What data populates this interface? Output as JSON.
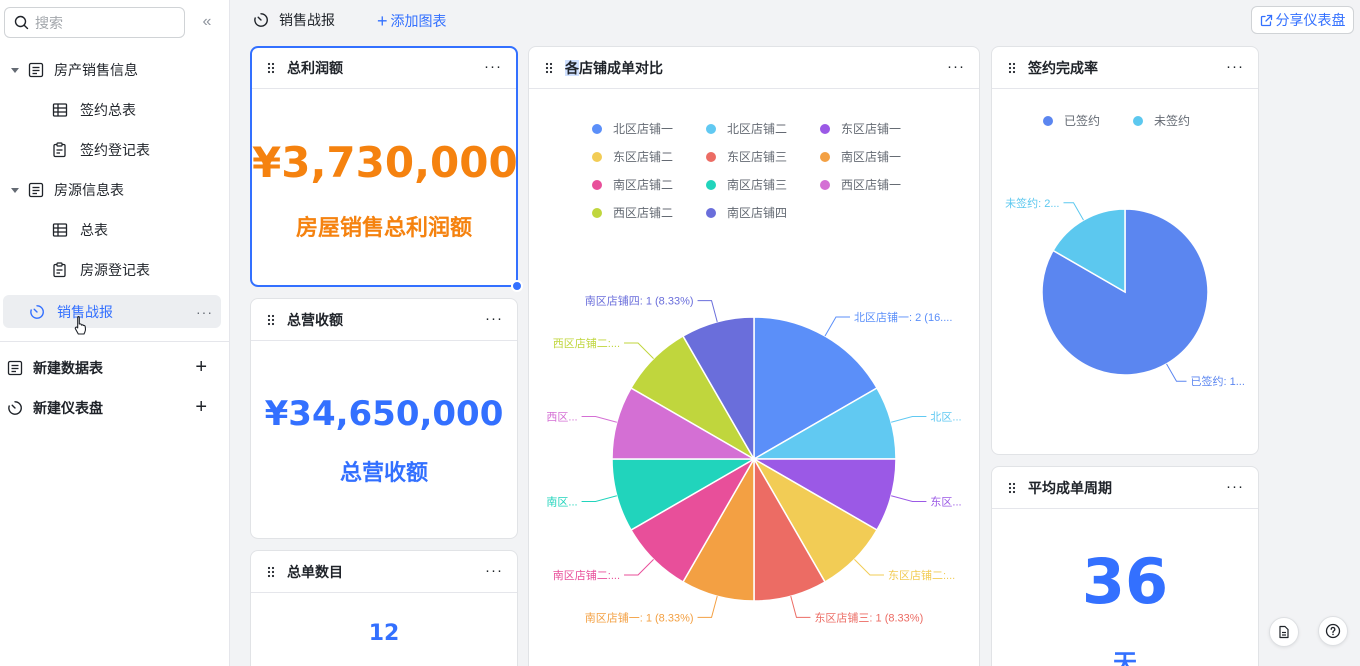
{
  "sidebar": {
    "search_placeholder": "搜索",
    "groups": [
      {
        "label": "房产销售信息",
        "children": [
          {
            "label": "签约总表"
          },
          {
            "label": "签约登记表"
          }
        ]
      },
      {
        "label": "房源信息表",
        "children": [
          {
            "label": "总表"
          },
          {
            "label": "房源登记表"
          }
        ]
      }
    ],
    "active_dashboard": "销售战报",
    "new_table": "新建数据表",
    "new_dashboard": "新建仪表盘"
  },
  "toolbar": {
    "dashboard_title": "销售战报",
    "add_chart": "添加图表",
    "share": "分享仪表盘"
  },
  "cards": {
    "profit": {
      "title": "总利润额",
      "value": "¥3,730,000",
      "label": "房屋销售总利润额",
      "color": "#f5820f"
    },
    "revenue": {
      "title": "总营收额",
      "value": "¥34,650,000",
      "label": "总营收额",
      "color": "#3370ff"
    },
    "orders": {
      "title": "总单数目",
      "value": "12"
    },
    "store_pie": {
      "title_hl": "各",
      "title_rest": "店铺成单对比"
    },
    "sign_rate": {
      "title": "签约完成率"
    },
    "cycle": {
      "title": "平均成单周期",
      "value": "36",
      "unit": "天"
    }
  },
  "chart_data": [
    {
      "type": "pie",
      "title": "各店铺成单对比",
      "categories": [
        "北区店铺一",
        "北区店铺二",
        "东区店铺一",
        "东区店铺二",
        "东区店铺三",
        "南区店铺一",
        "南区店铺二",
        "南区店铺三",
        "西区店铺一",
        "西区店铺二",
        "南区店铺四"
      ],
      "values": [
        2,
        1,
        1,
        1,
        1,
        1,
        1,
        1,
        1,
        1,
        1
      ],
      "colors": [
        "#5b8ff9",
        "#61c9f2",
        "#9b59e6",
        "#f2cc55",
        "#ec6c64",
        "#f3a043",
        "#e84f9a",
        "#21d4bc",
        "#d46fd4",
        "#c0d63d",
        "#6a6edb"
      ],
      "slice_labels": [
        "北区店铺一: 2 (16....",
        "北区...",
        "东区...",
        "东区店铺二:...",
        "东区店铺三: 1 (8.33%)",
        "南区店铺一: 1 (8.33%)",
        "南区店铺二:...",
        "南区...",
        "西区...",
        "西区店铺二:...",
        "南区店铺四: 1 (8.33%)"
      ],
      "legend": "top"
    },
    {
      "type": "pie",
      "title": "签约完成率",
      "categories": [
        "已签约",
        "未签约"
      ],
      "values": [
        10,
        2
      ],
      "colors": [
        "#5b86f0",
        "#5cc8ef"
      ],
      "slice_labels": [
        "已签约: 1...",
        "未签约: 2..."
      ],
      "legend": "top"
    }
  ]
}
